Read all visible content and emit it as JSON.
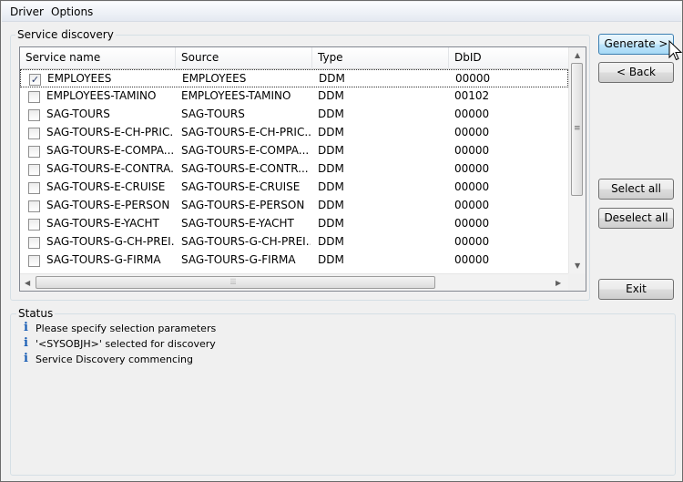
{
  "menu": {
    "items": [
      "Driver",
      "Options"
    ]
  },
  "service_discovery": {
    "title": "Service discovery",
    "columns": [
      "Service name",
      "Source",
      "Type",
      "DbID"
    ],
    "rows": [
      {
        "checked": true,
        "name": "EMPLOYEES",
        "source": "EMPLOYEES",
        "type": "DDM",
        "dbid": "00000"
      },
      {
        "checked": false,
        "name": "EMPLOYEES-TAMINO",
        "source": "EMPLOYEES-TAMINO",
        "type": "DDM",
        "dbid": "00102"
      },
      {
        "checked": false,
        "name": "SAG-TOURS",
        "source": "SAG-TOURS",
        "type": "DDM",
        "dbid": "00000"
      },
      {
        "checked": false,
        "name": "SAG-TOURS-E-CH-PRIC...",
        "source": "SAG-TOURS-E-CH-PRIC...",
        "type": "DDM",
        "dbid": "00000"
      },
      {
        "checked": false,
        "name": "SAG-TOURS-E-COMPA...",
        "source": "SAG-TOURS-E-COMPA...",
        "type": "DDM",
        "dbid": "00000"
      },
      {
        "checked": false,
        "name": "SAG-TOURS-E-CONTRA...",
        "source": "SAG-TOURS-E-CONTR...",
        "type": "DDM",
        "dbid": "00000"
      },
      {
        "checked": false,
        "name": "SAG-TOURS-E-CRUISE",
        "source": "SAG-TOURS-E-CRUISE",
        "type": "DDM",
        "dbid": "00000"
      },
      {
        "checked": false,
        "name": "SAG-TOURS-E-PERSON",
        "source": "SAG-TOURS-E-PERSON",
        "type": "DDM",
        "dbid": "00000"
      },
      {
        "checked": false,
        "name": "SAG-TOURS-E-YACHT",
        "source": "SAG-TOURS-E-YACHT",
        "type": "DDM",
        "dbid": "00000"
      },
      {
        "checked": false,
        "name": "SAG-TOURS-G-CH-PREI...",
        "source": "SAG-TOURS-G-CH-PREI...",
        "type": "DDM",
        "dbid": "00000"
      },
      {
        "checked": false,
        "name": "SAG-TOURS-G-FIRMA",
        "source": "SAG-TOURS-G-FIRMA",
        "type": "DDM",
        "dbid": "00000"
      }
    ]
  },
  "buttons": {
    "generate": "Generate >",
    "back": "< Back",
    "select_all": "Select all",
    "deselect_all": "Deselect all",
    "exit": "Exit"
  },
  "status": {
    "title": "Status",
    "messages": [
      "Please specify selection parameters",
      "'<SYSOBJH>' selected for discovery",
      "Service Discovery commencing"
    ]
  },
  "icons": {
    "check": "check-icon",
    "info": "info-icon",
    "cursor": "mouse-pointer-icon"
  },
  "colors": {
    "info_icon": "#1b5fb5",
    "default_button_border": "#3c7fb1"
  }
}
